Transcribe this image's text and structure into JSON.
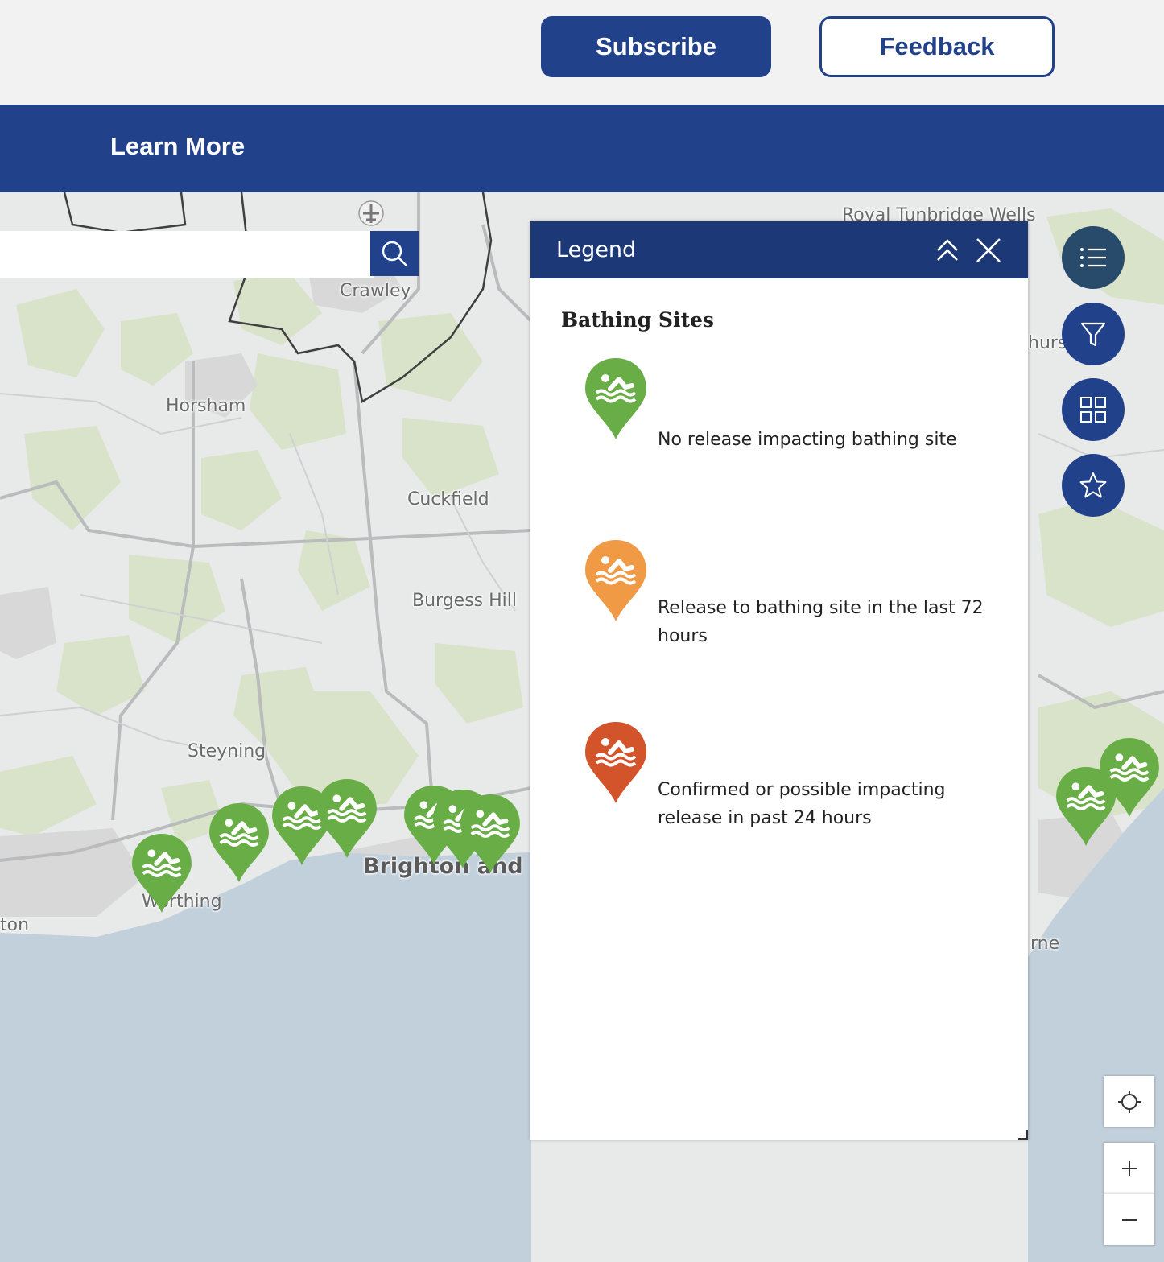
{
  "header": {
    "subscribe_label": "Subscribe",
    "feedback_label": "Feedback"
  },
  "nav": {
    "learn_more": "Learn More"
  },
  "search": {
    "value": "",
    "placeholder": ""
  },
  "map": {
    "places": {
      "royal_tunbridge_wells": "Royal Tunbridge Wells",
      "crawley": "Crawley",
      "horsham": "Horsham",
      "cuckfield": "Cuckfield",
      "burgess_hill": "Burgess Hill",
      "steyning": "Steyning",
      "brighton": "Brighton and H",
      "worthing": "Worthing",
      "littlehampton_fragment": "ton",
      "hurst_fragment": "hurs",
      "eastbourne_fragment": "rne"
    },
    "colors": {
      "land": "#e8eaea",
      "sea": "#c2d0dc",
      "green_area": "#d9e3c9",
      "road": "#b9bbbd",
      "boundary": "#3f3f3f",
      "pin_green": "#68ad45",
      "pin_orange": "#f19a45",
      "pin_red": "#d3532b",
      "brand_blue": "#22418b"
    }
  },
  "legend": {
    "title": "Legend",
    "section_title": "Bathing Sites",
    "items": [
      {
        "label": "No release impacting bathing site",
        "status": "green",
        "icon": "swimmer-pin-icon"
      },
      {
        "label": "Release to bathing site in the last 72 hours",
        "status": "orange",
        "icon": "swimmer-pin-icon"
      },
      {
        "label": "Confirmed or possible impacting release in past 24 hours",
        "status": "red",
        "icon": "swimmer-pin-icon"
      }
    ]
  },
  "toolbar": {
    "buttons": [
      "list-icon",
      "filter-icon",
      "grid-icon",
      "star-icon"
    ],
    "map_controls": [
      "locate-icon",
      "zoom-in-icon",
      "zoom-out-icon"
    ]
  }
}
